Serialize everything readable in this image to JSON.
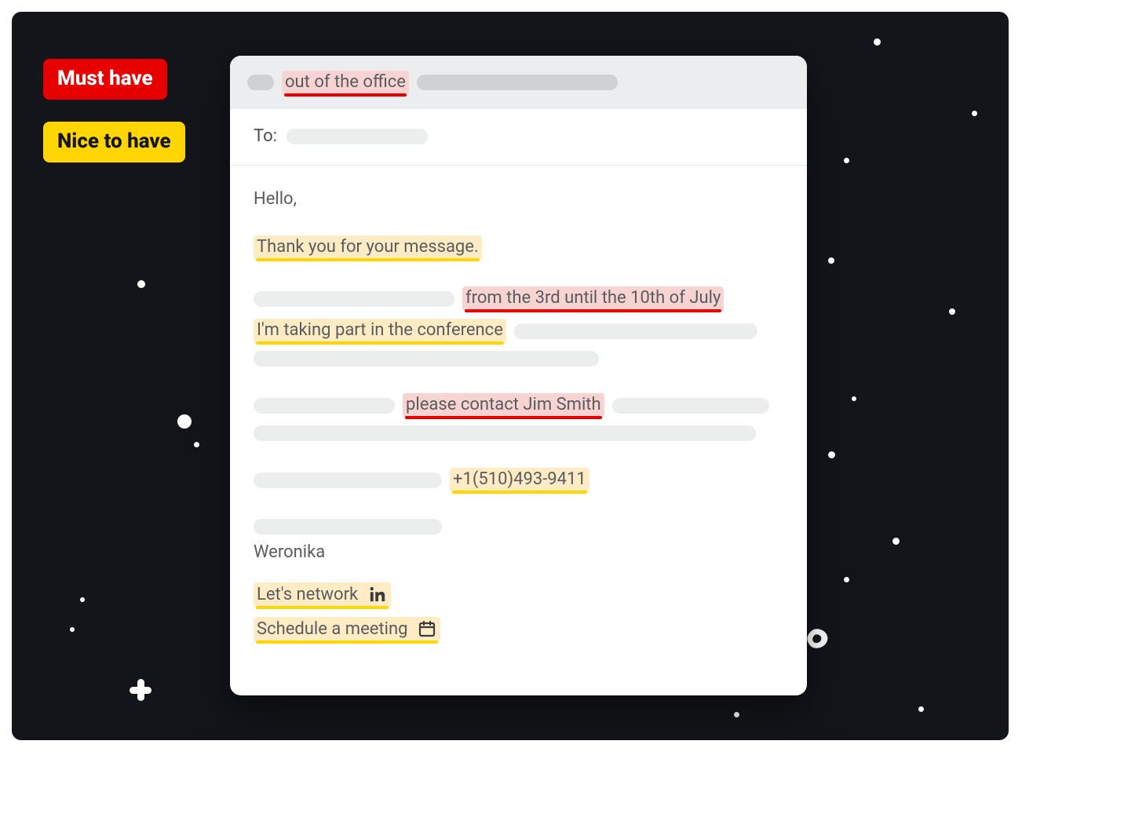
{
  "legend": {
    "must_have": "Must have",
    "nice_to_have": "Nice to have"
  },
  "email": {
    "subject_highlight": "out of the office",
    "to_label": "To:",
    "greeting": "Hello,",
    "thanks": "Thank you for your message.",
    "date_range": "from the 3rd until the 10th of July",
    "conference": "I'm taking part in the conference",
    "contact": "please contact Jim Smith",
    "phone": "+1(510)493-9411",
    "sender_name": "Weronika",
    "link_network": "Let's network",
    "link_schedule": "Schedule a meeting"
  },
  "icons": {
    "linkedin": "linkedin-icon",
    "calendar": "calendar-icon"
  },
  "colors": {
    "must_have_bg": "#e60000",
    "nice_to_have_bg": "#ffd600",
    "dark_bg": "#14151a",
    "red_hl_bg": "#f7d4d1",
    "yel_hl_bg": "#ffecc4"
  }
}
